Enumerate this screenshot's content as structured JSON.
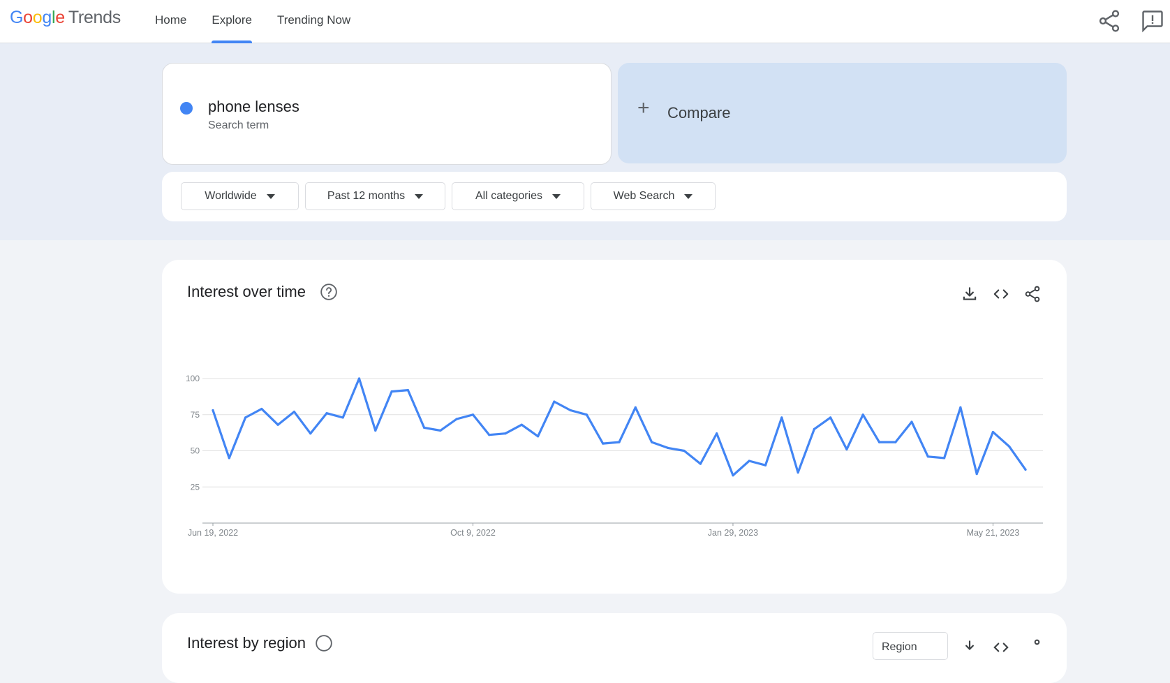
{
  "header": {
    "logo": {
      "google_letters": [
        "G",
        "o",
        "o",
        "g",
        "l",
        "e"
      ],
      "product": "Trends"
    },
    "nav": [
      {
        "label": "Home",
        "active": false
      },
      {
        "label": "Explore",
        "active": true
      },
      {
        "label": "Trending Now",
        "active": false
      }
    ],
    "icons": [
      "share-icon",
      "feedback-icon"
    ]
  },
  "search": {
    "term": "phone lenses",
    "term_type": "Search term",
    "term_color": "#4285f4",
    "compare_label": "Compare"
  },
  "filters": {
    "region": "Worldwide",
    "time": "Past 12 months",
    "category": "All categories",
    "property": "Web Search"
  },
  "interest_over_time": {
    "title": "Interest over time",
    "icons": [
      "help-icon",
      "download-icon",
      "embed-icon",
      "share-icon"
    ],
    "chart_data": {
      "type": "line",
      "title": "Interest over time",
      "xlabel": "",
      "ylabel": "",
      "ylim": [
        0,
        100
      ],
      "yticks": [
        25,
        50,
        75,
        100
      ],
      "x_tick_labels": [
        "Jun 19, 2022",
        "Oct 9, 2022",
        "Jan 29, 2023",
        "May 21, 2023"
      ],
      "grid": true,
      "series": [
        {
          "color": "#4285f4",
          "x": [
            "2022-06-19",
            "2022-06-26",
            "2022-07-03",
            "2022-07-10",
            "2022-07-17",
            "2022-07-24",
            "2022-07-31",
            "2022-08-07",
            "2022-08-14",
            "2022-08-21",
            "2022-08-28",
            "2022-09-04",
            "2022-09-11",
            "2022-09-18",
            "2022-09-25",
            "2022-10-02",
            "2022-10-09",
            "2022-10-16",
            "2022-10-23",
            "2022-10-30",
            "2022-11-06",
            "2022-11-13",
            "2022-11-20",
            "2022-11-27",
            "2022-12-04",
            "2022-12-11",
            "2022-12-18",
            "2022-12-25",
            "2023-01-01",
            "2023-01-08",
            "2023-01-15",
            "2023-01-22",
            "2023-01-29",
            "2023-02-05",
            "2023-02-12",
            "2023-02-19",
            "2023-02-26",
            "2023-03-05",
            "2023-03-12",
            "2023-03-19",
            "2023-03-26",
            "2023-04-02",
            "2023-04-09",
            "2023-04-16",
            "2023-04-23",
            "2023-04-30",
            "2023-05-07",
            "2023-05-14",
            "2023-05-21",
            "2023-05-28",
            "2023-06-04"
          ],
          "values": [
            78,
            45,
            73,
            79,
            68,
            77,
            62,
            76,
            73,
            100,
            64,
            91,
            92,
            66,
            64,
            72,
            75,
            61,
            62,
            68,
            60,
            84,
            78,
            75,
            55,
            56,
            80,
            56,
            52,
            50,
            41,
            62,
            33,
            43,
            40,
            73,
            35,
            65,
            73,
            51,
            75,
            56,
            56,
            70,
            46,
            45,
            80,
            34,
            63,
            53,
            37
          ]
        }
      ]
    }
  },
  "interest_by_region": {
    "title": "Interest by region",
    "select": "Region"
  }
}
